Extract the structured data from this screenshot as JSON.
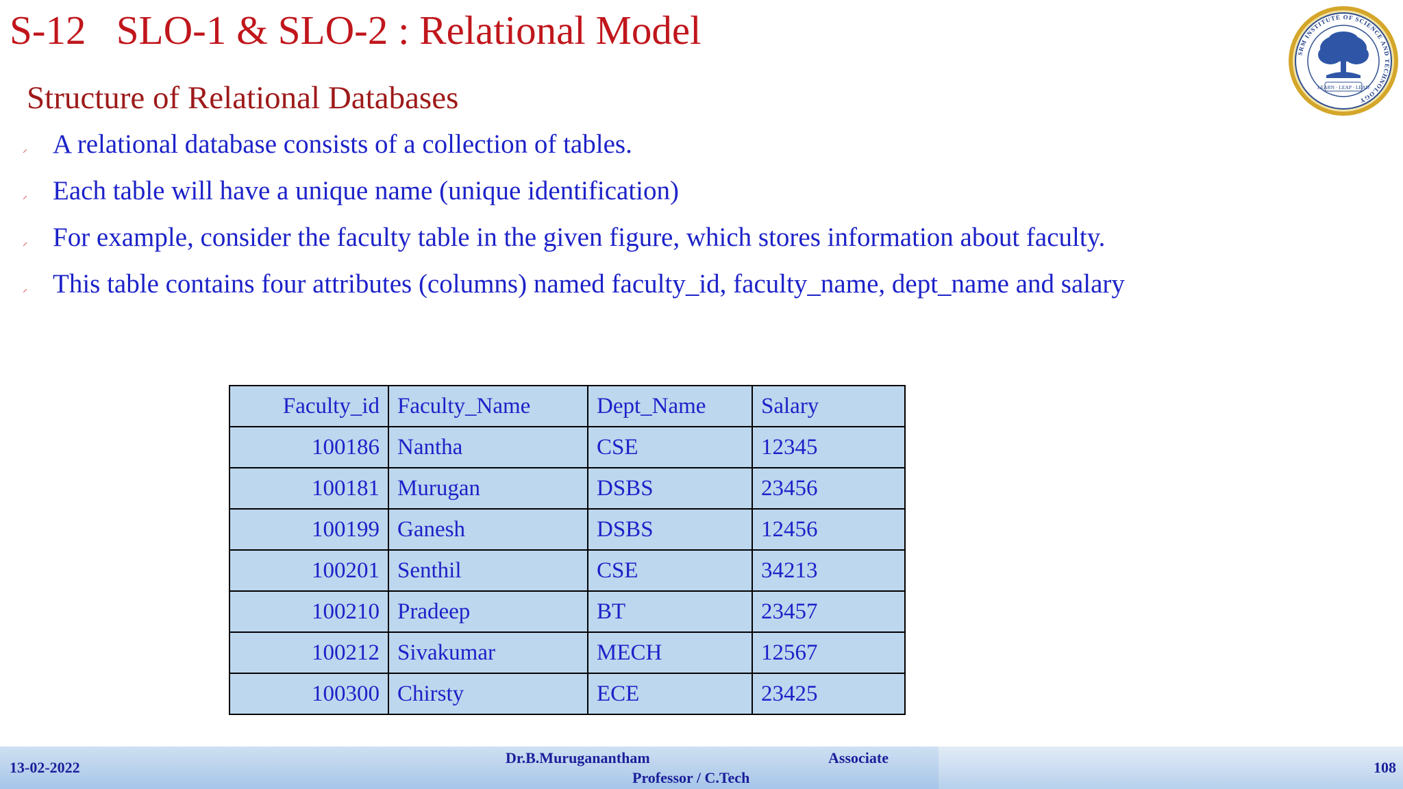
{
  "slide": {
    "title": "S-12   SLO-1 & SLO-2 : Relational Model",
    "subtitle": "Structure of Relational Databases",
    "logo": {
      "icon": "srm-institute-seal",
      "ring_text": "SRM INSTITUTE OF SCIENCE AND TECHNOLOGY",
      "motto": "LEARN · LEAP · LEAD"
    },
    "bullets": [
      "A relational database consists of a collection of tables.",
      "Each table will have a unique name (unique identification)",
      "For example, consider the faculty table in the given figure, which stores information about faculty.",
      "This table contains four attributes (columns) named faculty_id, faculty_name, dept_name and salary"
    ]
  },
  "table": {
    "headers": [
      "Faculty_id",
      "Faculty_Name",
      "Dept_Name",
      "Salary"
    ],
    "rows": [
      [
        "100186",
        "Nantha",
        "CSE",
        "12345"
      ],
      [
        "100181",
        "Murugan",
        "DSBS",
        "23456"
      ],
      [
        "100199",
        "Ganesh",
        "DSBS",
        "12456"
      ],
      [
        "100201",
        "Senthil",
        "CSE",
        "34213"
      ],
      [
        "100210",
        "Pradeep",
        "BT",
        "23457"
      ],
      [
        "100212",
        "Sivakumar",
        "MECH",
        "12567"
      ],
      [
        "100300",
        "Chirsty",
        "ECE",
        "23425"
      ]
    ]
  },
  "footer": {
    "date": "13-02-2022",
    "author": "Dr.B.Muruganantham",
    "role_line1": "Associate",
    "role_line2": "Professor / C.Tech",
    "page": "108"
  },
  "colors": {
    "title": "#c0161c",
    "body_text": "#1c22c8",
    "table_fill": "#bdd7ee",
    "footer_text": "#1a1f9a"
  }
}
